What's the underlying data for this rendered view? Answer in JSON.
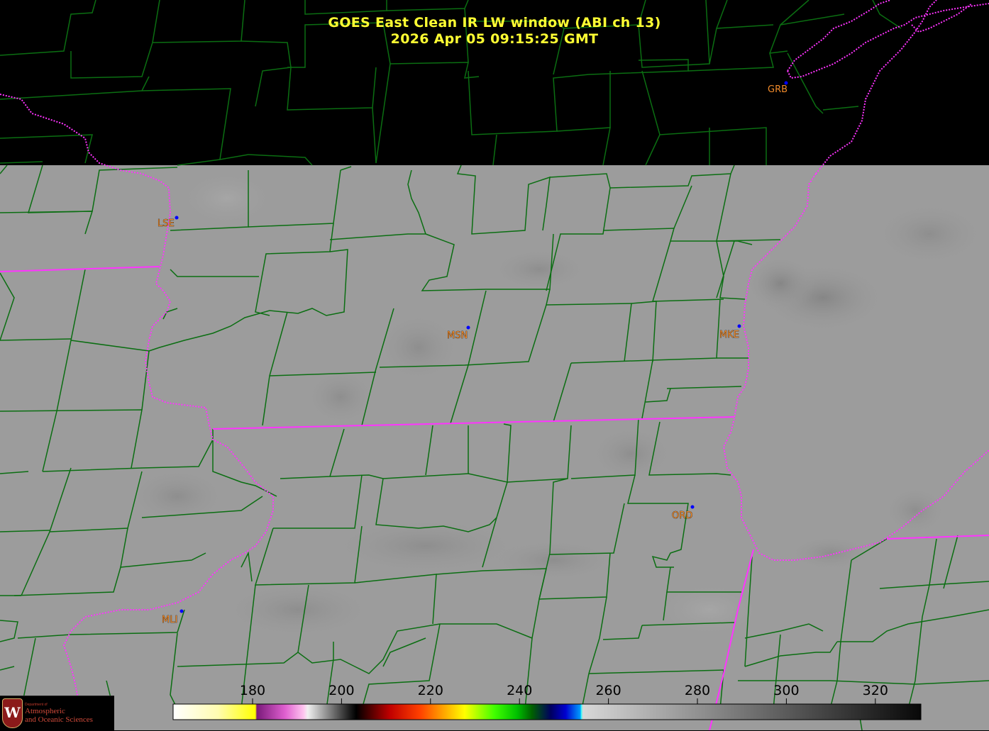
{
  "title": {
    "line1": "GOES East Clean IR LW window (ABI ch 13)",
    "line2": "2026 Apr 05  09:15:25 GMT"
  },
  "stations": [
    {
      "id": "GRB",
      "label": "GRB"
    },
    {
      "id": "LSE",
      "label": "LSE"
    },
    {
      "id": "MSN",
      "label": "MSN"
    },
    {
      "id": "MKE",
      "label": "MKE"
    },
    {
      "id": "ORD",
      "label": "ORD"
    },
    {
      "id": "MLI",
      "label": "MLI"
    }
  ],
  "colorbar": {
    "ticks": [
      "180",
      "200",
      "220",
      "240",
      "260",
      "280",
      "300",
      "320"
    ],
    "gradient_stops": [
      "#ffffff",
      "#ffff40",
      "#ffff00",
      "#800080",
      "#ff80ff",
      "#ffffff",
      "#000000",
      "#ff0000",
      "#ffff00",
      "#00ff00",
      "#000080",
      "#00ffff",
      "#c8c8c8",
      "#000000"
    ]
  },
  "logo": {
    "dept": "Department of",
    "line1": "Atmospheric",
    "line2": "and Oceanic Sciences",
    "shield_letter": "W"
  },
  "colors": {
    "title": "#ffff33",
    "county_lines": "#0b6e12",
    "state_lines": "#ff33ff",
    "station_label": "#f08a2a",
    "station_dot": "#0000ff",
    "imagery_gray": "#9c9c9c",
    "no_data": "#000000"
  }
}
